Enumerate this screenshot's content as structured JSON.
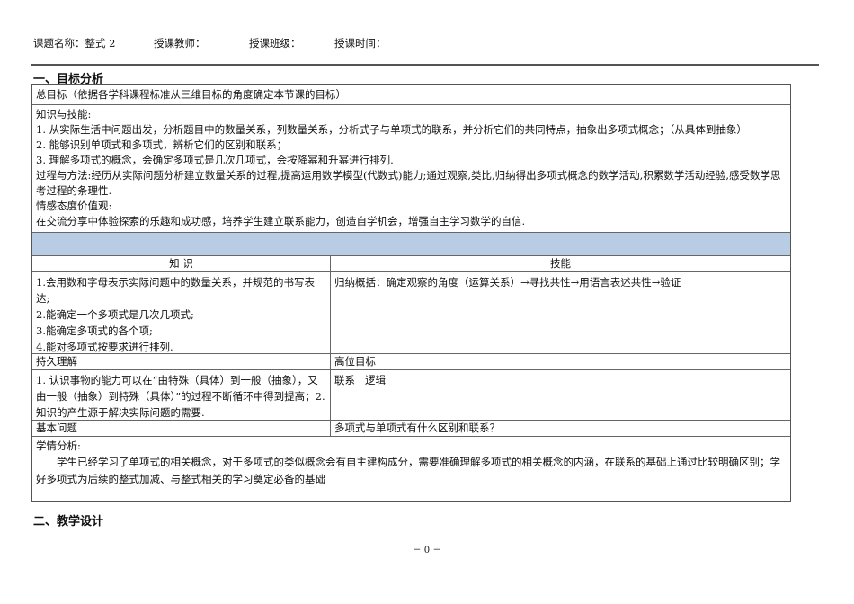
{
  "header": {
    "course": "课题名称：整式 2",
    "teacher": "授课教师：",
    "class": "授课班级：",
    "time": "授课时间："
  },
  "section1": "一、目标分析",
  "goal_title": "总目标（依据各学科课程标准从三维目标的角度确定本节课的目标）",
  "goals": [
    "知识与技能:",
    "1. 从实际生活中问题出发，分析题目中的数量关系，列数量关系，分析式子与单项式的联系，并分析它们的共同特点，抽象出多项式概念；（从具体到抽象）",
    "2. 能够识别单项式和多项式，辨析它们的区别和联系；",
    "3. 理解多项式的概念，会确定多项式是几次几项式，会按降幂和升幂进行排列.",
    "过程与方法:经历从实际问题分析建立数量关系的过程,提高运用数学模型(代数式)能力;通过观察,类比,归纳得出多项式概念的数学活动,积累数学活动经验,感受数学思考过程的条理性.",
    "情感态度价值观:",
    "在交流分享中体验探索的乐趣和成功感，培养学生建立联系能力，创造自学机会，增强自主学习数学的自信."
  ],
  "col_knowledge": "知  识",
  "col_skill": "技能",
  "knowledge": [
    "1.会用数和字母表示实际问题中的数量关系，并规范的书写表达;",
    "2.能确定一个多项式是几次几项式;",
    "3.能确定多项式的各个项;",
    "4.能对多项式按要求进行排列."
  ],
  "skill": "归纳概括：确定观察的角度（运算关系）→寻找共性→用语言表述共性→验证",
  "lasting_label": "持久理解",
  "high_label": "高位目标",
  "lasting": "1. 认识事物的能力可以在“由特殊（具体）到一般（抽象），又由一般（抽象）到特殊（具体）”的过程不断循环中得到提高；2. 知识的产生源于解决实际问题的需要.",
  "high": "联系   逻辑",
  "basic_label": "基本问题",
  "basic": "多项式与单项式有什么区别和联系？",
  "analysis_label": "学情分析:",
  "analysis": "学生已经学习了单项式的相关概念，对于多项式的类似概念会有自主建构成分，需要准确理解多项式的相关概念的内涵，在联系的基础上通过比较明确区别；学好多项式为后续的整式加减、与整式相关的学习奠定必备的基础",
  "section2": "二、教学设计",
  "page": "－ 0 －",
  "colors": {
    "band": "#b8cce4"
  }
}
